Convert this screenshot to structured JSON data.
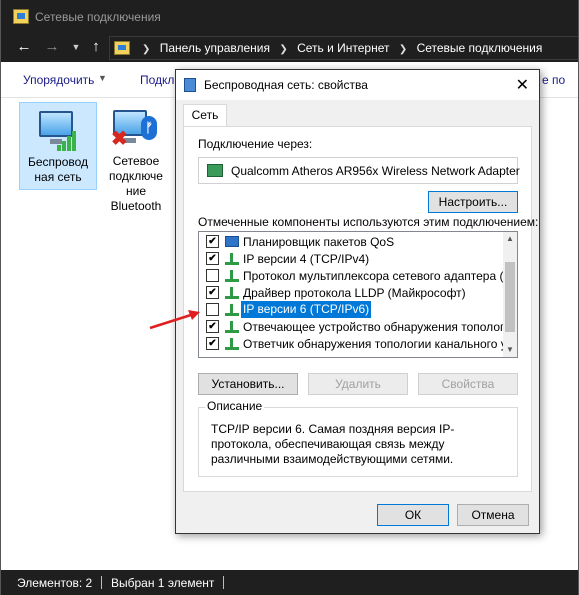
{
  "window": {
    "title": "Сетевые подключения"
  },
  "nav": {
    "back_icon": "arrow-left",
    "forward_icon": "arrow-right",
    "dropdown_icon": "chevron-down",
    "up_icon": "arrow-up"
  },
  "address": {
    "crumbs": [
      "Панель управления",
      "Сеть и Интернет",
      "Сетевые подключения"
    ]
  },
  "ribbon": {
    "organize": "Упорядочить",
    "connect": "Подкл",
    "right": "е по"
  },
  "files": [
    {
      "label_line1": "Беспровод",
      "label_line2": "ная сеть",
      "icon": "wifi-adapter-icon",
      "selected": true
    },
    {
      "label_line1": "Сетевое",
      "label_line2": "подключе",
      "label_line3": "ние",
      "label_line4": "Bluetooth",
      "icon": "bluetooth-adapter-icon",
      "selected": false
    }
  ],
  "status": {
    "items": "Элементов: 2",
    "selected": "Выбран 1 элемент"
  },
  "dialog": {
    "title": "Беспроводная сеть: свойства",
    "close": "✕",
    "tab": "Сеть",
    "connect_via_label": "Подключение через:",
    "adapter": "Qualcomm Atheros AR956x Wireless Network Adapter",
    "configure_button": "Настроить...",
    "components_label": "Отмеченные компоненты используются этим подключением:",
    "components": [
      {
        "checked": true,
        "icon": "scheduler",
        "label": "Планировщик пакетов QoS",
        "selected": false
      },
      {
        "checked": true,
        "icon": "net",
        "label": "IP версии 4 (TCP/IPv4)",
        "selected": false
      },
      {
        "checked": false,
        "icon": "net",
        "label": "Протокол мультиплексора сетевого адаптера (Майк",
        "selected": false
      },
      {
        "checked": true,
        "icon": "net",
        "label": "Драйвер протокола LLDP (Майкрософт)",
        "selected": false
      },
      {
        "checked": false,
        "icon": "net",
        "label": "IP версии 6 (TCP/IPv6)",
        "selected": true
      },
      {
        "checked": true,
        "icon": "net",
        "label": "Отвечающее устройство обнаружения топологии к...",
        "selected": false
      },
      {
        "checked": true,
        "icon": "net",
        "label": "Ответчик обнаружения топологии канального уровн",
        "selected": false
      }
    ],
    "install_button": "Установить...",
    "uninstall_button": "Удалить",
    "properties_button": "Свойства",
    "description_legend": "Описание",
    "description": "TCP/IP версии 6. Самая поздняя версия IP-протокола, обеспечивающая связь между различными взаимодействующими сетями.",
    "ok_button": "ОК",
    "cancel_button": "Отмена"
  },
  "colors": {
    "selection": "#0078d7",
    "titlebar": "#1f1f1f",
    "arrow": "#e02020"
  }
}
